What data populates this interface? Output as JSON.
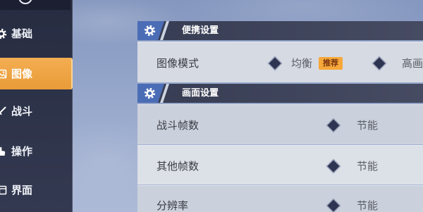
{
  "sidebar": {
    "items": [
      {
        "label": "基础",
        "icon": "gear-icon",
        "active": false
      },
      {
        "label": "图像",
        "icon": "image-icon",
        "active": true
      },
      {
        "label": "战斗",
        "icon": "battle-icon",
        "active": false
      },
      {
        "label": "操作",
        "icon": "controls-icon",
        "active": false
      },
      {
        "label": "界面",
        "icon": "interface-icon",
        "active": false
      }
    ]
  },
  "sections": [
    {
      "title": "便携设置",
      "icon": "gear-icon",
      "rows": [
        {
          "label": "图像模式",
          "options": [
            {
              "label": "均衡",
              "badge": "推荐"
            },
            {
              "label": "高画"
            }
          ]
        }
      ]
    },
    {
      "title": "画面设置",
      "icon": "gear-icon",
      "rows": [
        {
          "label": "战斗帧数",
          "option": {
            "label": "节能"
          }
        },
        {
          "label": "其他帧数",
          "option": {
            "label": "节能"
          }
        },
        {
          "label": "分辨率",
          "option": {
            "label": "节能"
          }
        }
      ]
    }
  ],
  "colors": {
    "accent": "#f2a23a",
    "sidebar_bg": "#2d334b",
    "section_header_bg": "#3a4058",
    "section_icon_bg": "#4b6db6",
    "badge_bg": "#f6a83a",
    "option_marker": "#2e3552"
  }
}
